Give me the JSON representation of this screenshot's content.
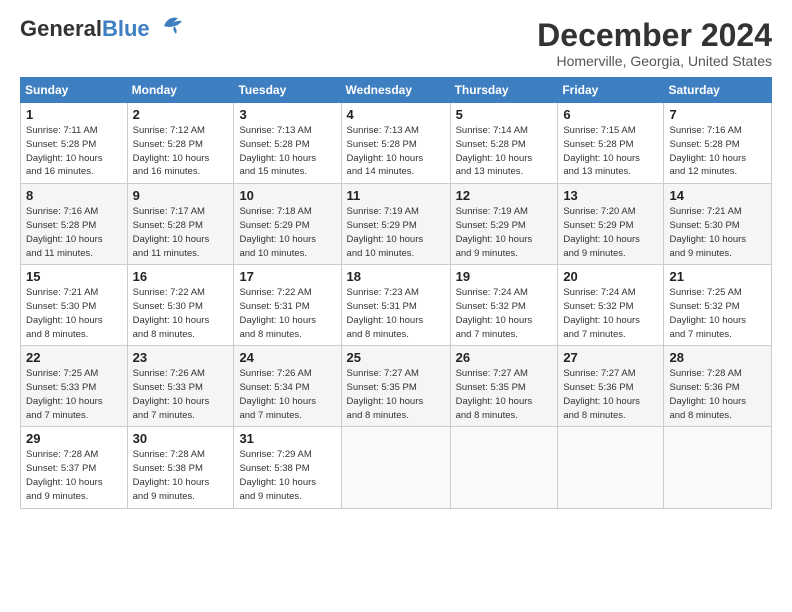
{
  "header": {
    "logo_general": "General",
    "logo_blue": "Blue",
    "month": "December 2024",
    "location": "Homerville, Georgia, United States"
  },
  "weekdays": [
    "Sunday",
    "Monday",
    "Tuesday",
    "Wednesday",
    "Thursday",
    "Friday",
    "Saturday"
  ],
  "weeks": [
    [
      {
        "day": "1",
        "info": "Sunrise: 7:11 AM\nSunset: 5:28 PM\nDaylight: 10 hours\nand 16 minutes."
      },
      {
        "day": "2",
        "info": "Sunrise: 7:12 AM\nSunset: 5:28 PM\nDaylight: 10 hours\nand 16 minutes."
      },
      {
        "day": "3",
        "info": "Sunrise: 7:13 AM\nSunset: 5:28 PM\nDaylight: 10 hours\nand 15 minutes."
      },
      {
        "day": "4",
        "info": "Sunrise: 7:13 AM\nSunset: 5:28 PM\nDaylight: 10 hours\nand 14 minutes."
      },
      {
        "day": "5",
        "info": "Sunrise: 7:14 AM\nSunset: 5:28 PM\nDaylight: 10 hours\nand 13 minutes."
      },
      {
        "day": "6",
        "info": "Sunrise: 7:15 AM\nSunset: 5:28 PM\nDaylight: 10 hours\nand 13 minutes."
      },
      {
        "day": "7",
        "info": "Sunrise: 7:16 AM\nSunset: 5:28 PM\nDaylight: 10 hours\nand 12 minutes."
      }
    ],
    [
      {
        "day": "8",
        "info": "Sunrise: 7:16 AM\nSunset: 5:28 PM\nDaylight: 10 hours\nand 11 minutes."
      },
      {
        "day": "9",
        "info": "Sunrise: 7:17 AM\nSunset: 5:28 PM\nDaylight: 10 hours\nand 11 minutes."
      },
      {
        "day": "10",
        "info": "Sunrise: 7:18 AM\nSunset: 5:29 PM\nDaylight: 10 hours\nand 10 minutes."
      },
      {
        "day": "11",
        "info": "Sunrise: 7:19 AM\nSunset: 5:29 PM\nDaylight: 10 hours\nand 10 minutes."
      },
      {
        "day": "12",
        "info": "Sunrise: 7:19 AM\nSunset: 5:29 PM\nDaylight: 10 hours\nand 9 minutes."
      },
      {
        "day": "13",
        "info": "Sunrise: 7:20 AM\nSunset: 5:29 PM\nDaylight: 10 hours\nand 9 minutes."
      },
      {
        "day": "14",
        "info": "Sunrise: 7:21 AM\nSunset: 5:30 PM\nDaylight: 10 hours\nand 9 minutes."
      }
    ],
    [
      {
        "day": "15",
        "info": "Sunrise: 7:21 AM\nSunset: 5:30 PM\nDaylight: 10 hours\nand 8 minutes."
      },
      {
        "day": "16",
        "info": "Sunrise: 7:22 AM\nSunset: 5:30 PM\nDaylight: 10 hours\nand 8 minutes."
      },
      {
        "day": "17",
        "info": "Sunrise: 7:22 AM\nSunset: 5:31 PM\nDaylight: 10 hours\nand 8 minutes."
      },
      {
        "day": "18",
        "info": "Sunrise: 7:23 AM\nSunset: 5:31 PM\nDaylight: 10 hours\nand 8 minutes."
      },
      {
        "day": "19",
        "info": "Sunrise: 7:24 AM\nSunset: 5:32 PM\nDaylight: 10 hours\nand 7 minutes."
      },
      {
        "day": "20",
        "info": "Sunrise: 7:24 AM\nSunset: 5:32 PM\nDaylight: 10 hours\nand 7 minutes."
      },
      {
        "day": "21",
        "info": "Sunrise: 7:25 AM\nSunset: 5:32 PM\nDaylight: 10 hours\nand 7 minutes."
      }
    ],
    [
      {
        "day": "22",
        "info": "Sunrise: 7:25 AM\nSunset: 5:33 PM\nDaylight: 10 hours\nand 7 minutes."
      },
      {
        "day": "23",
        "info": "Sunrise: 7:26 AM\nSunset: 5:33 PM\nDaylight: 10 hours\nand 7 minutes."
      },
      {
        "day": "24",
        "info": "Sunrise: 7:26 AM\nSunset: 5:34 PM\nDaylight: 10 hours\nand 7 minutes."
      },
      {
        "day": "25",
        "info": "Sunrise: 7:27 AM\nSunset: 5:35 PM\nDaylight: 10 hours\nand 8 minutes."
      },
      {
        "day": "26",
        "info": "Sunrise: 7:27 AM\nSunset: 5:35 PM\nDaylight: 10 hours\nand 8 minutes."
      },
      {
        "day": "27",
        "info": "Sunrise: 7:27 AM\nSunset: 5:36 PM\nDaylight: 10 hours\nand 8 minutes."
      },
      {
        "day": "28",
        "info": "Sunrise: 7:28 AM\nSunset: 5:36 PM\nDaylight: 10 hours\nand 8 minutes."
      }
    ],
    [
      {
        "day": "29",
        "info": "Sunrise: 7:28 AM\nSunset: 5:37 PM\nDaylight: 10 hours\nand 9 minutes."
      },
      {
        "day": "30",
        "info": "Sunrise: 7:28 AM\nSunset: 5:38 PM\nDaylight: 10 hours\nand 9 minutes."
      },
      {
        "day": "31",
        "info": "Sunrise: 7:29 AM\nSunset: 5:38 PM\nDaylight: 10 hours\nand 9 minutes."
      },
      null,
      null,
      null,
      null
    ]
  ]
}
